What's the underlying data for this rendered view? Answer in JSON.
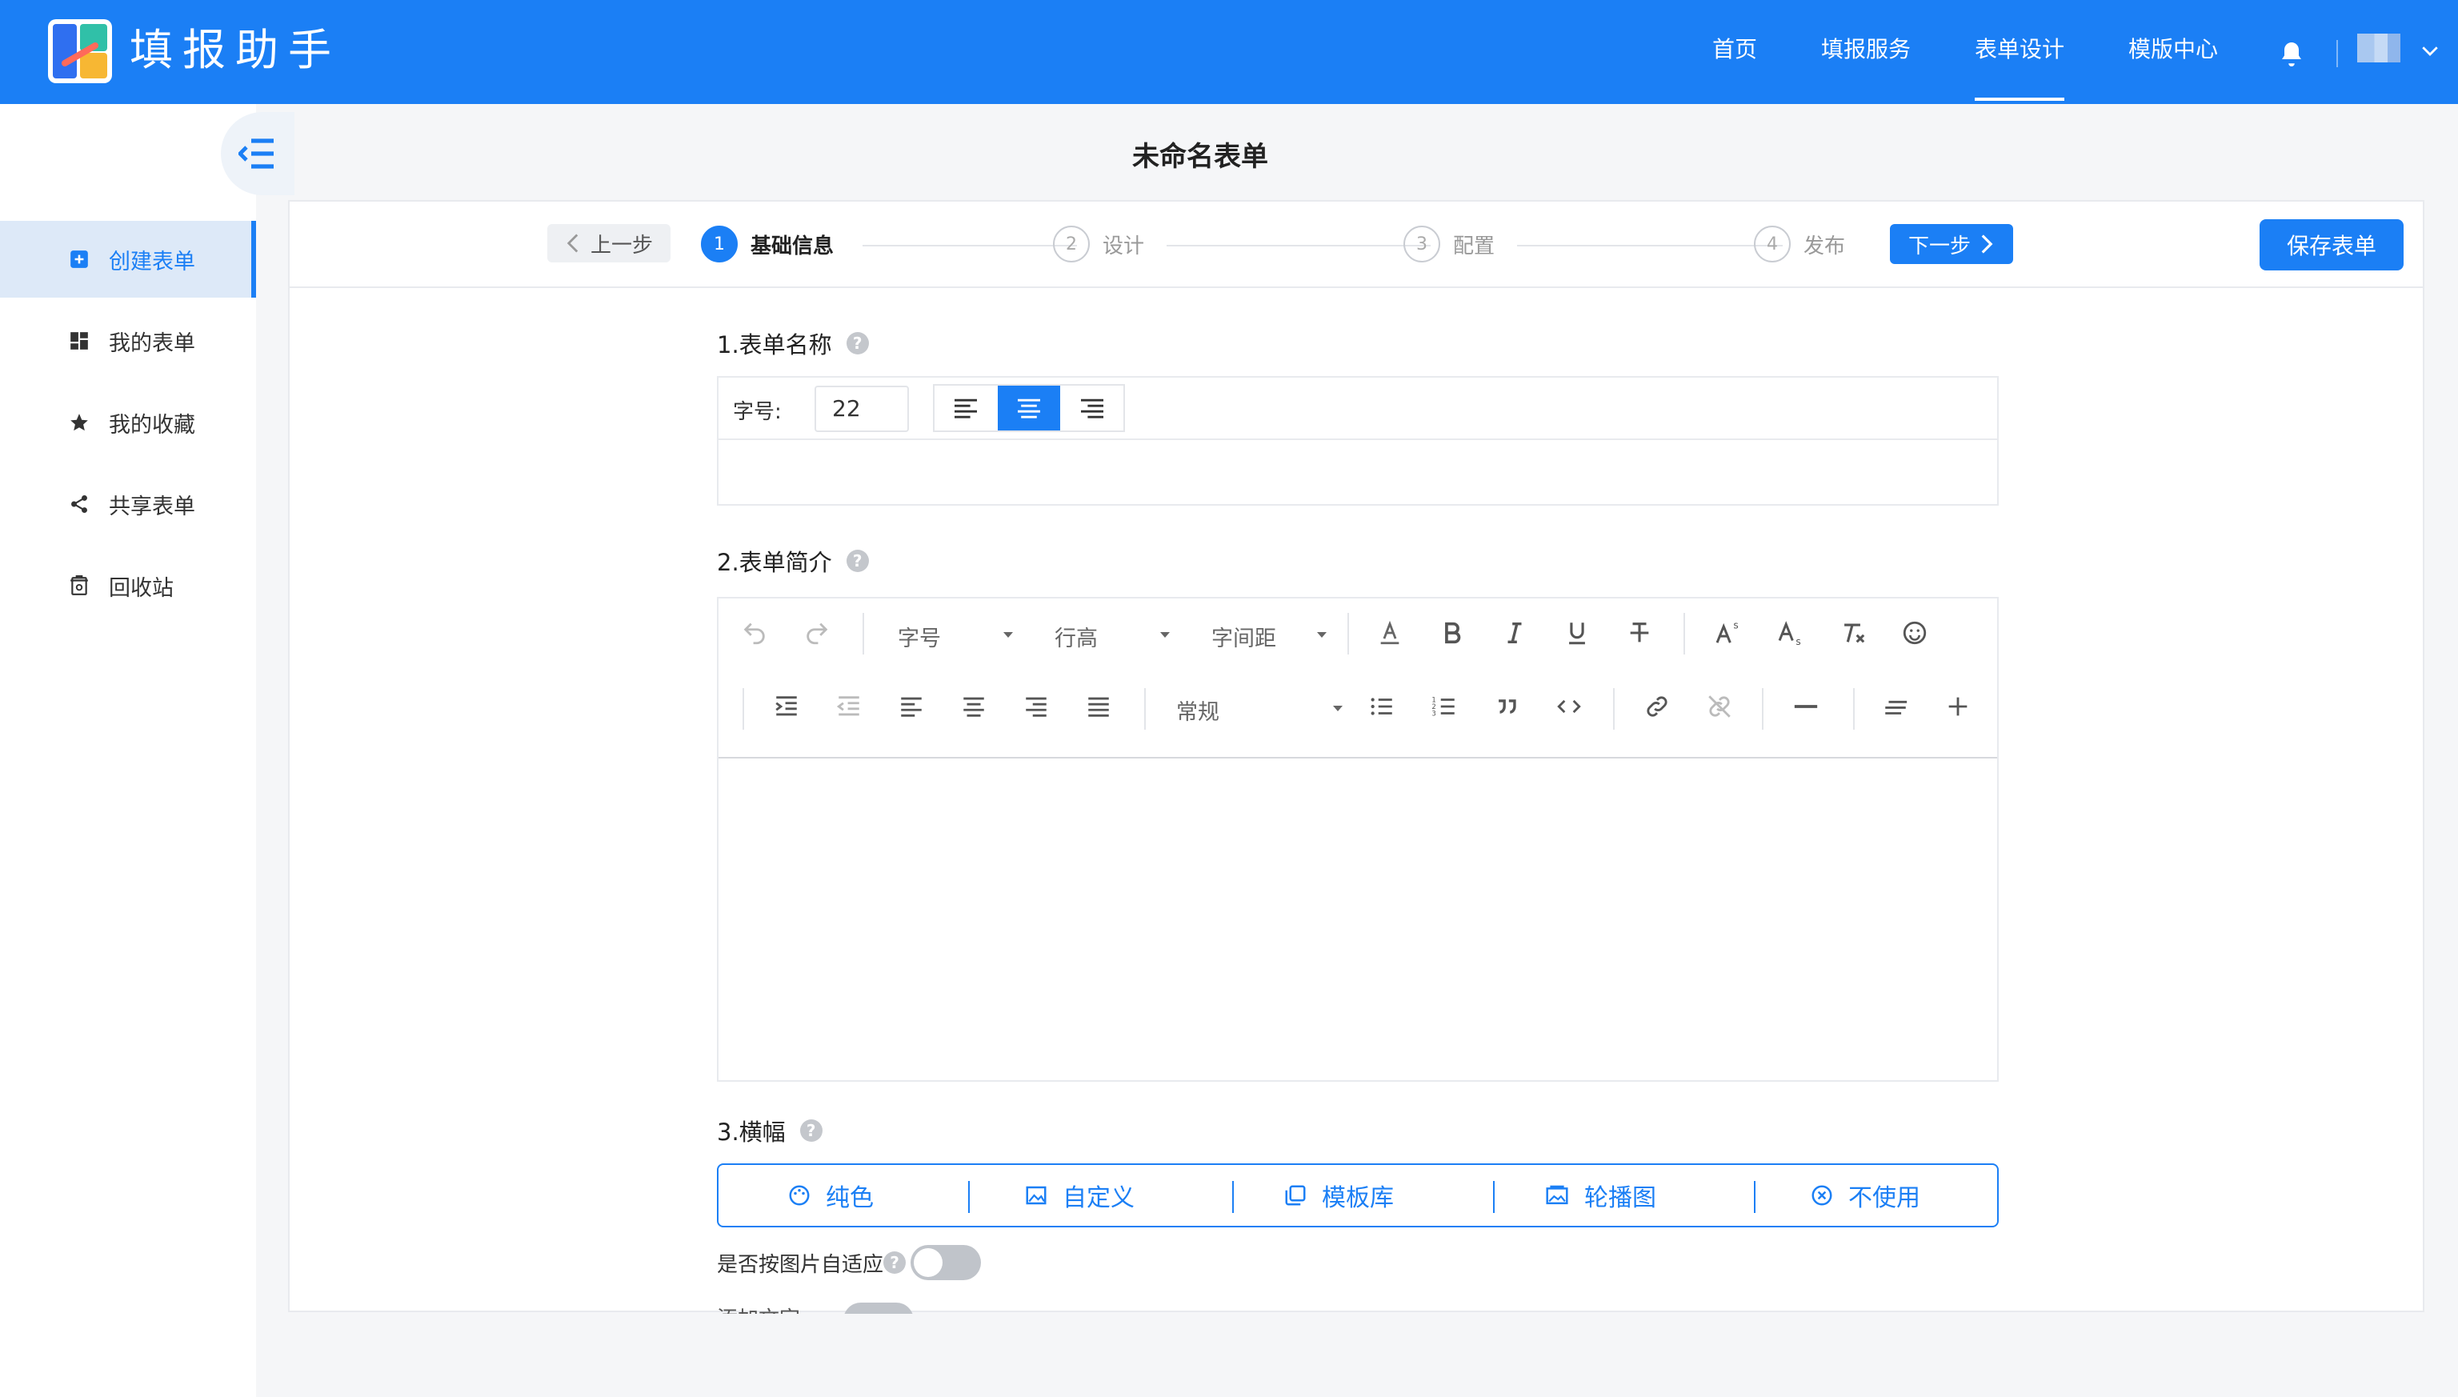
{
  "header": {
    "app_title": "填报助手",
    "nav": [
      "首页",
      "填报服务",
      "表单设计",
      "模版中心"
    ],
    "active_nav": "表单设计",
    "brand_color": "#1b7ff5"
  },
  "sidebar": {
    "items": [
      {
        "label": "创建表单",
        "icon": "create-form-icon",
        "active": true
      },
      {
        "label": "我的表单",
        "icon": "grid-icon",
        "active": false
      },
      {
        "label": "我的收藏",
        "icon": "star-icon",
        "active": false
      },
      {
        "label": "共享表单",
        "icon": "share-icon",
        "active": false
      },
      {
        "label": "回收站",
        "icon": "trash-icon",
        "active": false
      }
    ]
  },
  "form": {
    "title": "未命名表单",
    "prev_label": "上一步",
    "next_label": "下一步",
    "save_label": "保存表单",
    "steps": [
      {
        "num": "1",
        "label": "基础信息",
        "active": true
      },
      {
        "num": "2",
        "label": "设计",
        "active": false
      },
      {
        "num": "3",
        "label": "配置",
        "active": false
      },
      {
        "num": "4",
        "label": "发布",
        "active": false
      }
    ]
  },
  "section1": {
    "title": "1.表单名称",
    "font_size_label": "字号:",
    "font_size_value": "22",
    "align_active": "center"
  },
  "section2": {
    "title": "2.表单简介",
    "dropdowns": {
      "font_size": "字号",
      "line_height": "行高",
      "letter_spacing": "字间距",
      "paragraph": "常规"
    }
  },
  "section3": {
    "title": "3.横幅",
    "options": [
      {
        "label": "纯色",
        "icon": "palette-icon"
      },
      {
        "label": "自定义",
        "icon": "image-icon"
      },
      {
        "label": "模板库",
        "icon": "template-icon"
      },
      {
        "label": "轮播图",
        "icon": "carousel-icon"
      },
      {
        "label": "不使用",
        "icon": "close-circle-icon"
      }
    ],
    "adaptive_label": "是否按图片自适应",
    "adaptive_on": false,
    "cut_label": "添加文字"
  }
}
